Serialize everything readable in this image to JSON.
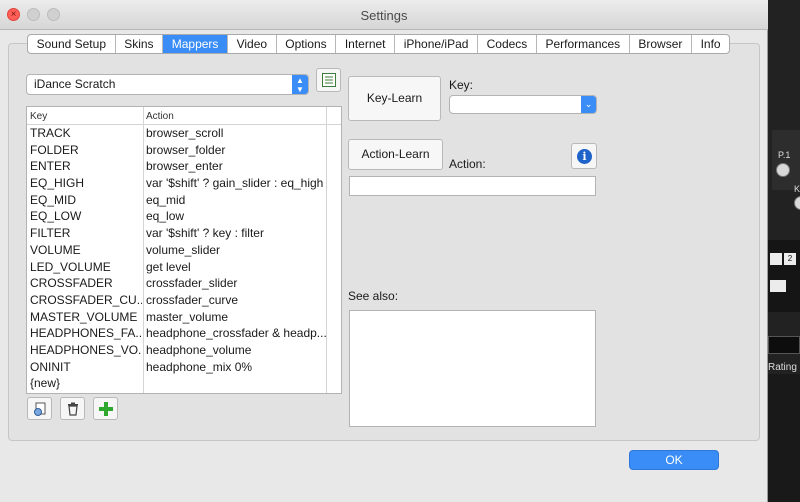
{
  "window": {
    "title": "Settings"
  },
  "tabs": [
    {
      "label": "Sound Setup",
      "active": false
    },
    {
      "label": "Skins",
      "active": false
    },
    {
      "label": "Mappers",
      "active": true
    },
    {
      "label": "Video",
      "active": false
    },
    {
      "label": "Options",
      "active": false
    },
    {
      "label": "Internet",
      "active": false
    },
    {
      "label": "iPhone/iPad",
      "active": false
    },
    {
      "label": "Codecs",
      "active": false
    },
    {
      "label": "Performances",
      "active": false
    },
    {
      "label": "Browser",
      "active": false
    },
    {
      "label": "Info",
      "active": false
    }
  ],
  "mapper": {
    "selected": "iDance Scratch",
    "columns": {
      "key": "Key",
      "action": "Action"
    },
    "rows": [
      {
        "key": "TRACK",
        "action": "browser_scroll"
      },
      {
        "key": "FOLDER",
        "action": "browser_folder"
      },
      {
        "key": "ENTER",
        "action": "browser_enter"
      },
      {
        "key": "EQ_HIGH",
        "action": "var '$shift' ? gain_slider : eq_high"
      },
      {
        "key": "EQ_MID",
        "action": "eq_mid"
      },
      {
        "key": "EQ_LOW",
        "action": "eq_low"
      },
      {
        "key": "FILTER",
        "action": "var '$shift' ? key : filter"
      },
      {
        "key": "VOLUME",
        "action": "volume_slider"
      },
      {
        "key": "LED_VOLUME",
        "action": "get level"
      },
      {
        "key": "CROSSFADER",
        "action": "crossfader_slider"
      },
      {
        "key": "CROSSFADER_CU...",
        "action": "crossfader_curve"
      },
      {
        "key": "MASTER_VOLUME",
        "action": "master_volume"
      },
      {
        "key": "HEADPHONES_FA...",
        "action": "headphone_crossfader & headp..."
      },
      {
        "key": "HEADPHONES_VO...",
        "action": "headphone_volume"
      },
      {
        "key": "ONINIT",
        "action": "headphone_mix 0%"
      },
      {
        "key": "{new}",
        "action": ""
      }
    ]
  },
  "editor": {
    "key_learn_label": "Key-Learn",
    "key_label": "Key:",
    "key_value": "",
    "action_learn_label": "Action-Learn",
    "action_label": "Action:",
    "action_value": "",
    "see_also_label": "See also:",
    "info_icon": "i"
  },
  "footer": {
    "ok_label": "OK"
  },
  "background_app": {
    "label_p1": "P.1",
    "label_ke": "KE",
    "btn_2": "2",
    "rating_label": "Rating"
  },
  "colors": {
    "accent": "#3a8df6",
    "close": "#ff5f57",
    "add": "#2ea82e",
    "info": "#1d63c9"
  }
}
